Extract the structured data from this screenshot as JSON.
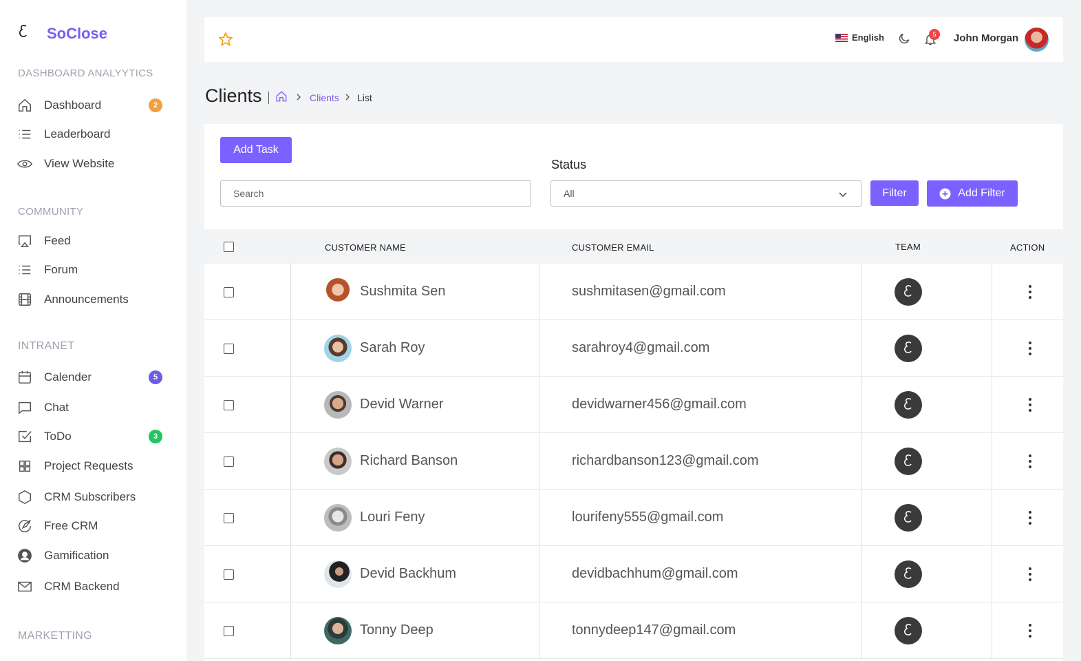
{
  "brand": {
    "name": "SoClose"
  },
  "sidebar": {
    "sections": [
      {
        "title": "DASHBOARD ANALYYTICS"
      },
      {
        "title": "COMMUNITY"
      },
      {
        "title": "INTRANET"
      },
      {
        "title": "MARKETTING"
      }
    ],
    "items": [
      {
        "label": "Dashboard",
        "badge": "2",
        "icon": "home-icon"
      },
      {
        "label": "Leaderboard",
        "icon": "list-icon"
      },
      {
        "label": "View Website",
        "icon": "eye-icon"
      },
      {
        "label": "Feed",
        "icon": "cast-icon"
      },
      {
        "label": "Forum",
        "icon": "list-icon"
      },
      {
        "label": "Announcements",
        "icon": "film-icon"
      },
      {
        "label": "Calender",
        "badge": "5",
        "icon": "calendar-icon"
      },
      {
        "label": "Chat",
        "icon": "chat-icon"
      },
      {
        "label": "ToDo",
        "badge": "3",
        "icon": "check-square-icon"
      },
      {
        "label": "Project Requests",
        "icon": "grid-icon"
      },
      {
        "label": "CRM Subscribers",
        "icon": "hexagon-icon"
      },
      {
        "label": "Free CRM",
        "icon": "compass-icon"
      },
      {
        "label": "Gamification",
        "icon": "user-circle-icon"
      },
      {
        "label": "CRM Backend",
        "icon": "mail-icon"
      }
    ],
    "badge_colors": {
      "orange": "#f59e3b",
      "purple": "#6c5ce7",
      "green": "#22c55e"
    }
  },
  "header": {
    "language": "English",
    "notification_count": "5",
    "user_name": "John Morgan"
  },
  "page": {
    "title": "Clients",
    "breadcrumb": {
      "link": "Clients",
      "current": "List"
    }
  },
  "toolbar": {
    "add_task_label": "Add Task",
    "status_label": "Status",
    "search_placeholder": "Search",
    "status_value": "All",
    "filter_label": "Filter",
    "add_filter_label": "Add Filter"
  },
  "table": {
    "columns": [
      "CUSTOMER NAME",
      "CUSTOMER EMAIL",
      "TEAM",
      "ACTION"
    ],
    "rows": [
      {
        "name": "Sushmita Sen",
        "email": "sushmitasen@gmail.com"
      },
      {
        "name": "Sarah Roy",
        "email": "sarahroy4@gmail.com"
      },
      {
        "name": "Devid Warner",
        "email": "devidwarner456@gmail.com"
      },
      {
        "name": "Richard Banson",
        "email": "richardbanson123@gmail.com"
      },
      {
        "name": "Louri Feny",
        "email": "lourifeny555@gmail.com"
      },
      {
        "name": "Devid Backhum",
        "email": "devidbachhum@gmail.com"
      },
      {
        "name": "Tonny Deep",
        "email": "tonnydeep147@gmail.com"
      }
    ]
  },
  "colors": {
    "accent": "#7b61ff",
    "brand": "#7c5cf0"
  }
}
